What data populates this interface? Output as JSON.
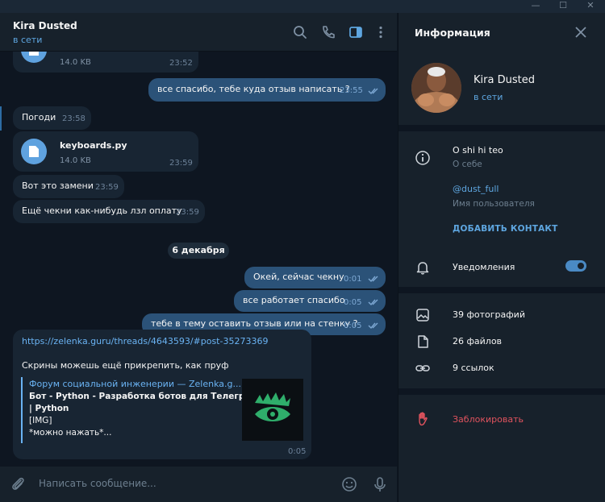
{
  "chat": {
    "contact_name": "Kira Dusted",
    "status": "в сети",
    "messages": [
      {
        "type": "file",
        "direction": "in",
        "size": "14.0 KB",
        "time": "23:52"
      },
      {
        "type": "text",
        "direction": "out",
        "text": "все спасибо, тебе куда отзыв написать ?",
        "time": "23:55"
      },
      {
        "type": "text",
        "direction": "in",
        "text": "Погоди",
        "time": "23:58"
      },
      {
        "type": "file",
        "direction": "in",
        "filename": "keyboards.py",
        "size": "14.0 KB",
        "time": "23:59"
      },
      {
        "type": "text",
        "direction": "in",
        "text": "Вот это замени",
        "time": "23:59"
      },
      {
        "type": "text",
        "direction": "in",
        "text": "Ещё чекни как-нибудь лзл оплату",
        "time": "23:59"
      },
      {
        "type": "date",
        "text": "6 декабря"
      },
      {
        "type": "text",
        "direction": "out",
        "text": "Окей, сейчас чекну",
        "time": "0:01"
      },
      {
        "type": "text",
        "direction": "out",
        "text": "все работает спасибо",
        "time": "0:05"
      },
      {
        "type": "text",
        "direction": "out",
        "text": "тебе в тему оставить отзыв или на стенку ?",
        "time": "0:05"
      },
      {
        "type": "link",
        "direction": "in",
        "url": "https://zelenka.guru/threads/4643593/#post-35273369",
        "text": "Скрины можешь ещё прикрепить, как пруф",
        "preview_site": "Форум социальной инженерии — Zelenka.g...",
        "preview_title_1": "Бот - Python - Разработка ботов для Телеграм",
        "preview_title_2": "| Python",
        "preview_line_3": "[IMG]",
        "preview_line_4": "*можно нажать*...",
        "time": "0:05"
      }
    ],
    "composer_placeholder": "Написать сообщение..."
  },
  "info_panel": {
    "title": "Информация",
    "name": "Kira Dusted",
    "status": "в сети",
    "bio": "O shi hi teo",
    "bio_label": "О себе",
    "username": "@dust_full",
    "username_label": "Имя пользователя",
    "add_contact": "ДОБАВИТЬ КОНТАКТ",
    "notifications": "Уведомления",
    "notifications_on": true,
    "photos": "39 фотографий",
    "files": "26 файлов",
    "links": "9 ссылок",
    "block": "Заблокировать"
  },
  "colors": {
    "background": "#0e1621",
    "panel": "#17212b",
    "incoming_bubble": "#182533",
    "outgoing_bubble": "#2b5278",
    "accent": "#5ea6e0",
    "danger": "#e0535e"
  }
}
